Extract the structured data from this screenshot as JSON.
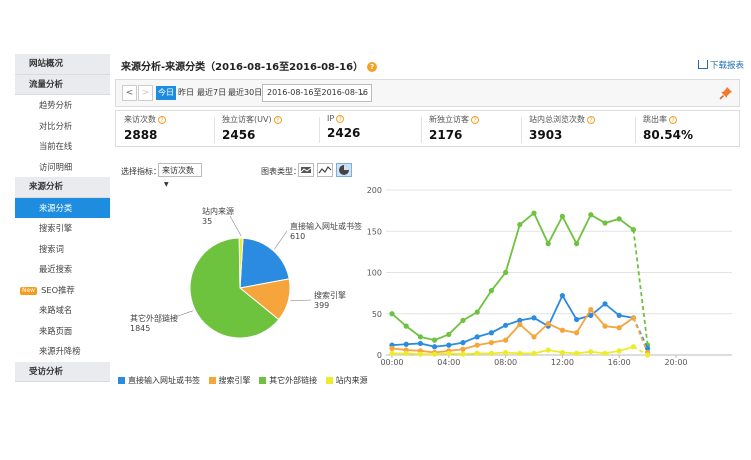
{
  "sidebar": {
    "items": [
      {
        "label": "网站概况",
        "kind": "head"
      },
      {
        "label": "流量分析",
        "kind": "head"
      },
      {
        "label": "趋势分析",
        "kind": "sub"
      },
      {
        "label": "对比分析",
        "kind": "sub"
      },
      {
        "label": "当前在线",
        "kind": "sub"
      },
      {
        "label": "访问明细",
        "kind": "sub"
      },
      {
        "label": "来源分析",
        "kind": "head"
      },
      {
        "label": "来源分类",
        "kind": "sub",
        "active": true
      },
      {
        "label": "搜索引擎",
        "kind": "sub"
      },
      {
        "label": "搜索词",
        "kind": "sub"
      },
      {
        "label": "最近搜索",
        "kind": "sub"
      },
      {
        "label": "SEO推荐",
        "kind": "sub",
        "badge": "New"
      },
      {
        "label": "来路域名",
        "kind": "sub"
      },
      {
        "label": "来路页面",
        "kind": "sub"
      },
      {
        "label": "来源升降榜",
        "kind": "sub"
      },
      {
        "label": "受访分析",
        "kind": "head"
      }
    ]
  },
  "header": {
    "title": "来源分析-来源分类（2016-08-16至2016-08-16）",
    "help_icon": "?",
    "download_label": "下载报表"
  },
  "toolbar": {
    "prev": "<",
    "next": ">",
    "ranges": [
      "今日",
      "昨日",
      "最近7日",
      "最近30日"
    ],
    "active_range": "今日",
    "date_range": "2016-08-16至2016-08-16"
  },
  "stats": [
    {
      "label": "来访次数",
      "value": "2888"
    },
    {
      "label": "独立访客(UV)",
      "value": "2456"
    },
    {
      "label": "IP",
      "value": "2426"
    },
    {
      "label": "新独立访客",
      "value": "2176"
    },
    {
      "label": "站内总浏览次数",
      "value": "3903"
    },
    {
      "label": "跳出率",
      "value": "80.54%"
    }
  ],
  "controls": {
    "metric_label": "选择指标：",
    "metric_value": "来访次数",
    "chart_type_label": "图表类型："
  },
  "colors": {
    "blue": "#2b8be0",
    "orange": "#f5a53c",
    "green": "#6dc23e",
    "yellow": "#ecec2c",
    "accent": "#1e8de0"
  },
  "chart_data": [
    {
      "type": "pie",
      "slices": [
        {
          "name": "直接输入网址或书签",
          "value": 610,
          "color": "#2b8be0",
          "label": "直接输入网址或书签"
        },
        {
          "name": "搜索引擎",
          "value": 399,
          "color": "#f5a53c",
          "label": "搜索引擎"
        },
        {
          "name": "其它外部链接",
          "value": 1845,
          "color": "#6dc23e",
          "label": "其它外部链接"
        },
        {
          "name": "站内来源",
          "value": 35,
          "color": "#ecec2c",
          "label": "站内来源"
        }
      ]
    },
    {
      "type": "line",
      "x_ticks": [
        "00:00",
        "04:00",
        "08:00",
        "12:00",
        "16:00",
        "20:00"
      ],
      "y_ticks": [
        "0",
        "50",
        "100",
        "150",
        "200"
      ],
      "ylim": [
        0,
        200
      ],
      "xlim": [
        0,
        21
      ],
      "series": [
        {
          "name": "其它外部链接",
          "color": "#6dc23e",
          "values": [
            50,
            35,
            22,
            18,
            25,
            42,
            52,
            78,
            100,
            158,
            172,
            135,
            168,
            135,
            170,
            160,
            165,
            152,
            12
          ]
        },
        {
          "name": "直接输入网址或书签",
          "color": "#2b8be0",
          "values": [
            12,
            13,
            14,
            10,
            12,
            15,
            22,
            27,
            36,
            42,
            45,
            35,
            72,
            43,
            48,
            62,
            48,
            45,
            8
          ]
        },
        {
          "name": "搜索引擎",
          "color": "#f5a53c",
          "values": [
            8,
            6,
            5,
            3,
            5,
            7,
            12,
            15,
            18,
            37,
            22,
            38,
            30,
            27,
            55,
            35,
            33,
            45,
            3
          ]
        },
        {
          "name": "站内来源",
          "color": "#ecec2c",
          "values": [
            2,
            2,
            1,
            1,
            2,
            1,
            2,
            2,
            3,
            2,
            2,
            6,
            3,
            2,
            4,
            2,
            5,
            10,
            0
          ]
        }
      ]
    }
  ],
  "legend": [
    "直接输入网址或书签",
    "搜索引擎",
    "其它外部链接",
    "站内来源"
  ]
}
